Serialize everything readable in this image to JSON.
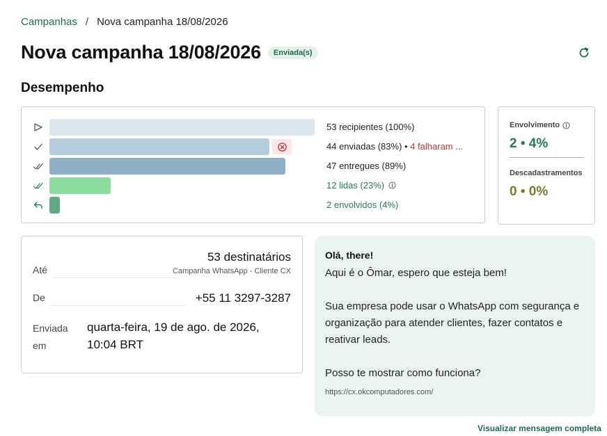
{
  "breadcrumb": {
    "parent": "Campanhas",
    "separator": "/",
    "current": "Nova campanha 18/08/2026"
  },
  "header": {
    "title": "Nova campanha 18/08/2026",
    "status": "Enviada(s)",
    "refresh_icon": "refresh-icon"
  },
  "performance": {
    "section_title": "Desempenho",
    "rows": [
      {
        "icon": "send-icon",
        "label": "53 recipientes (100%)",
        "percent": 100,
        "color": "#dbe5ec"
      },
      {
        "icon": "check-icon",
        "label_main": "44 enviadas (83%)",
        "separator": "•",
        "label_fail": "4 falharam ...",
        "percent": 83,
        "color": "#b5cedb"
      },
      {
        "icon": "double-check-icon",
        "label": "47 entregues (89%)",
        "percent": 89,
        "color": "#8fafc4"
      },
      {
        "icon": "double-check-read-icon",
        "label": "12 lidas (23%)",
        "percent": 23,
        "color": "#8ddd9f"
      },
      {
        "icon": "reply-icon",
        "label": "2 envolvidos (4%)",
        "percent": 4,
        "color": "#5fa882"
      }
    ]
  },
  "engagement": {
    "involvement_label": "Envolvimento",
    "involvement_value": "2 • 4%",
    "unsub_label": "Descadastramentos",
    "unsub_value": "0 • 0%",
    "colors": {
      "involvement": "#2a7a55",
      "unsub": "#7a7a2a"
    }
  },
  "details": {
    "to_label": "Até",
    "to_value": "53 destinatários",
    "to_sub": "Campanha WhatsApp - Cliente CX",
    "from_label": "De",
    "from_value": "+55 11 3297-3287",
    "sent_label": "Enviada em",
    "sent_value": "quarta-feira, 19 de ago. de 2026, 10:04 BRT"
  },
  "message": {
    "greeting": "Olá, there!",
    "body": "Aqui é o Ômar, espero que esteja bem!\n\nSua empresa pode usar o WhatsApp com segurança e organização para atender clientes, fazer contatos e reativar leads.\n\nPosso te mostrar como funciona?",
    "link": "https://cx.okcomputadores.com/"
  },
  "footer": {
    "view_full": "Visualizar mensagem completa"
  }
}
